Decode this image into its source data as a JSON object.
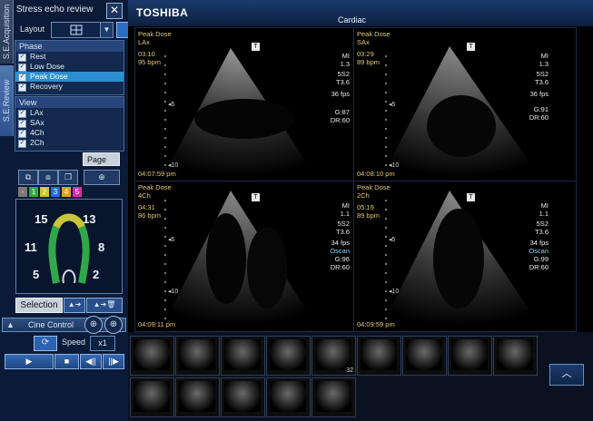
{
  "side_tabs": {
    "acquisition": "S.E.Acquisition",
    "review": "S.E.Review"
  },
  "panel": {
    "title": "Stress echo review",
    "close": "✕",
    "layout_label": "Layout",
    "layout_icon": "grid-icon",
    "dropdown": "▼"
  },
  "phase": {
    "header": "Phase",
    "items": [
      {
        "label": "Rest",
        "checked": true,
        "selected": false
      },
      {
        "label": "Low Dose",
        "checked": true,
        "selected": false
      },
      {
        "label": "Peak Dose",
        "checked": true,
        "selected": true
      },
      {
        "label": "Recovery",
        "checked": true,
        "selected": false
      }
    ]
  },
  "view": {
    "header": "View",
    "items": [
      {
        "label": "LAx",
        "checked": true
      },
      {
        "label": "SAx",
        "checked": true
      },
      {
        "label": "4Ch",
        "checked": true
      },
      {
        "label": "2Ch",
        "checked": true
      }
    ]
  },
  "page_button": "Page",
  "scores": {
    "swatches": [
      "-",
      "1",
      "2",
      "3",
      "4",
      "5"
    ],
    "swatch_colors": [
      "#7a7a7a",
      "#2fa84a",
      "#c9c43a",
      "#1f6fd8",
      "#e0a020",
      "#d8309a"
    ],
    "segments": [
      "15",
      "13",
      "11",
      "8",
      "5",
      "2"
    ]
  },
  "selection_button": "Selection",
  "cine": {
    "label": "Cine Control",
    "speed_label": "Speed",
    "speed_value": "x1",
    "play": "▶",
    "stop": "■",
    "prev": "◀||",
    "next": "||▶"
  },
  "header": {
    "brand": "TOSHIBA",
    "view_name": "Cardiac"
  },
  "quads": [
    {
      "phase": "Peak Dose",
      "view": "LAx",
      "time": "03:10",
      "hr": "95 bpm",
      "mi": "MI",
      "mi_val": "1.3",
      "probe": "5S2",
      "t": "T3.6",
      "fps": "36 fps",
      "gain": "G:87",
      "dr": "DR:60",
      "clock": "04:07:59 pm"
    },
    {
      "phase": "Peak Dose",
      "view": "SAx",
      "time": "03:29",
      "hr": "89 bpm",
      "mi": "MI",
      "mi_val": "1.3",
      "probe": "5S2",
      "t": "T3.6",
      "fps": "36 fps",
      "gain": "G:91",
      "dr": "DR:60",
      "clock": "04:08:10 pm"
    },
    {
      "phase": "Peak Dose",
      "view": "4Ch",
      "time": "04:31",
      "hr": "86 bpm",
      "mi": "MI",
      "mi_val": "1.1",
      "probe": "5S2",
      "t": "T3.6",
      "fps": "34 fps",
      "scan": "Oscan",
      "gain": "G:96",
      "dr": "DR:60",
      "clock": "04:09:11 pm"
    },
    {
      "phase": "Peak Dose",
      "view": "2Ch",
      "time": "05:19",
      "hr": "89 bpm",
      "mi": "MI",
      "mi_val": "1.1",
      "probe": "5S2",
      "t": "T3.6",
      "fps": "34 fps",
      "scan": "Oscan",
      "gain": "G:99",
      "dr": "DR:60",
      "clock": "04:09:59 pm"
    }
  ],
  "thumbnails": {
    "row1": [
      "",
      "",
      "",
      "",
      "",
      "32",
      "",
      "",
      "",
      ""
    ],
    "row2": [
      "",
      "",
      "",
      "",
      "",
      ""
    ]
  },
  "scroll_up": "︿"
}
